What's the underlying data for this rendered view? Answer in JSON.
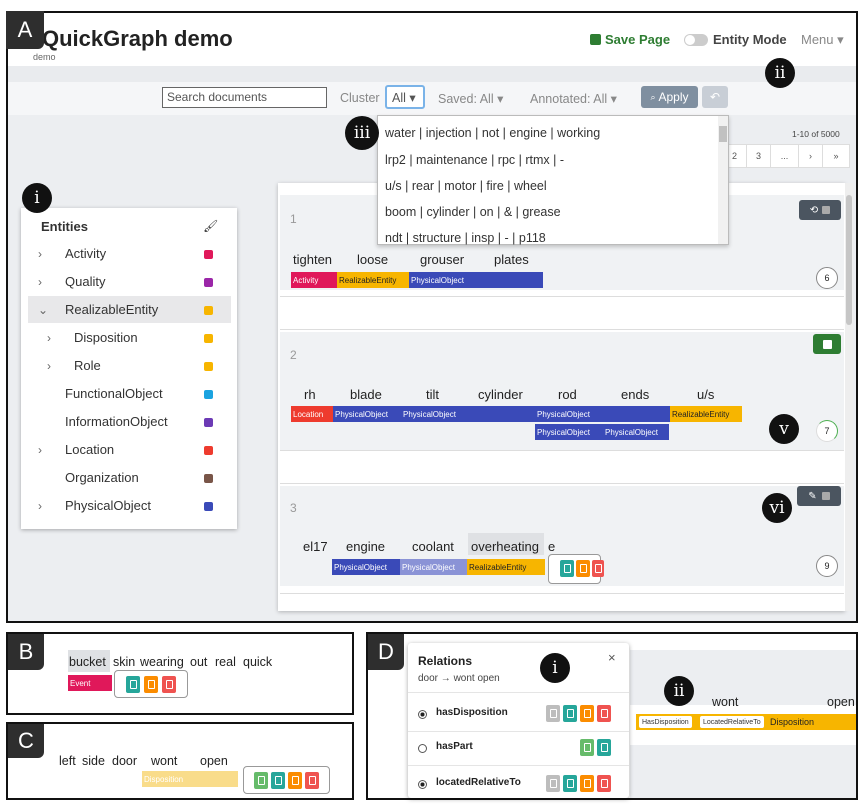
{
  "panels": {
    "A": "A",
    "B": "B",
    "C": "C",
    "D": "D"
  },
  "roman": {
    "i": "i",
    "ii": "ii",
    "iii": "iii",
    "v": "v",
    "vi": "vi",
    "d_i": "i",
    "d_ii": "ii"
  },
  "header": {
    "title": "QuickGraph demo",
    "subtitle": "demo",
    "save_label": "Save Page",
    "entity_mode_label": "Entity Mode",
    "menu_label": "Menu"
  },
  "toolbar": {
    "search_placeholder": "Search documents",
    "cluster_label": "Cluster",
    "cluster_value": "All",
    "saved_label": "Saved:",
    "saved_value": "All",
    "annotated_label": "Annotated:",
    "annotated_value": "All",
    "apply_label": "Apply"
  },
  "pagination": {
    "range": "1-10 of 5000",
    "pages": [
      "2",
      "3",
      "...",
      "›",
      "»"
    ]
  },
  "cluster_options": [
    "water | injection | not | engine | working",
    "lrp2 | maintenance | rpc | rtmx | -",
    "u/s | rear | motor | fire | wheel",
    "boom | cylinder | on | & | grease",
    "ndt | structure | insp | - | p118"
  ],
  "entities": {
    "title": "Entities",
    "items": [
      {
        "label": "Activity",
        "color": "#e0185a",
        "chev": ">"
      },
      {
        "label": "Quality",
        "color": "#9b26a8",
        "chev": ">"
      },
      {
        "label": "RealizableEntity",
        "color": "#f7b500",
        "chev": "v"
      },
      {
        "label": "Disposition",
        "color": "#f7b500",
        "chev": ">"
      },
      {
        "label": "Role",
        "color": "#f7b500",
        "chev": ">"
      },
      {
        "label": "FunctionalObject",
        "color": "#1ba3e0",
        "chev": ""
      },
      {
        "label": "InformationObject",
        "color": "#6c3ab5",
        "chev": ""
      },
      {
        "label": "Location",
        "color": "#ee3b2e",
        "chev": ">"
      },
      {
        "label": "Organization",
        "color": "#795548",
        "chev": ""
      },
      {
        "label": "PhysicalObject",
        "color": "#3a4ab8",
        "chev": ">"
      }
    ]
  },
  "docs": [
    {
      "num": "1",
      "tokens": [
        "tighten",
        "loose",
        "grouser",
        "plates"
      ],
      "tags": [
        "Activity",
        "RealizableEntity",
        "PhysicalObject"
      ],
      "count": "6"
    },
    {
      "num": "2",
      "tokens": [
        "rh",
        "blade",
        "tilt",
        "cylinder",
        "rod",
        "ends",
        "u/s"
      ],
      "tags": [
        "Location",
        "PhysicalObject",
        "PhysicalObject",
        "PhysicalObject",
        "RealizableEntity",
        "PhysicalObject",
        "PhysicalObject"
      ],
      "count": "7"
    },
    {
      "num": "3",
      "tokens": [
        "el17",
        "engine",
        "coolant",
        "overheating",
        "e"
      ],
      "tags": [
        "PhysicalObject",
        "PhysicalObject",
        "RealizableEntity"
      ],
      "count": "9"
    }
  ],
  "panelB": {
    "tokens": [
      "bucket",
      "skin",
      "wearing",
      "out",
      "real",
      "quick"
    ],
    "tag": "Event"
  },
  "panelC": {
    "tokens": [
      "left",
      "side",
      "door",
      "wont",
      "open"
    ],
    "tag": "Disposition"
  },
  "panelD": {
    "title": "Relations",
    "subtitle": "door → wont open",
    "close": "×",
    "relations": [
      {
        "label": "hasDisposition",
        "checked": true
      },
      {
        "label": "hasPart",
        "checked": false
      },
      {
        "label": "locatedRelativeTo",
        "checked": true
      }
    ],
    "tokens": [
      "wont",
      "open"
    ],
    "tags": [
      "HasDisposition",
      "LocatedRelativeTo",
      "Disposition"
    ]
  },
  "colors": {
    "physical": "#3a4ab8",
    "activity": "#e0185a",
    "realizable": "#f7b500",
    "location": "#ee3b2e",
    "teal": "#26a69a",
    "orange": "#fb8c00",
    "red": "#ef5350",
    "green": "#66bb6a",
    "gray": "#bdbdbd",
    "save_green": "#2e7d32"
  }
}
